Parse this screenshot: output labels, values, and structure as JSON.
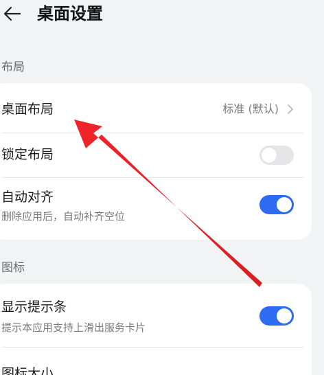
{
  "header": {
    "title": "桌面设置",
    "back_icon": "arrow-left-icon"
  },
  "sections": {
    "layout": {
      "label": "布局",
      "rows": {
        "desktop_layout": {
          "title": "桌面布局",
          "value": "标准 (默认)"
        },
        "lock_layout": {
          "title": "锁定布局",
          "toggle": false
        },
        "auto_align": {
          "title": "自动对齐",
          "subtitle": "删除应用后，自动补齐空位",
          "toggle": true
        }
      }
    },
    "icons": {
      "label": "图标",
      "rows": {
        "show_hint_bar": {
          "title": "显示提示条",
          "subtitle": "提示本应用支持上滑出服务卡片",
          "toggle": true
        },
        "icon_size": {
          "title": "图标大小"
        }
      }
    }
  },
  "annotation": {
    "type": "arrow",
    "color": "#e8272b",
    "points_to": "desktop_layout"
  },
  "colors": {
    "toggle_on": "#2d6bf0",
    "toggle_off": "#e6e6e8",
    "background": "#f1f3f5",
    "card": "#ffffff"
  }
}
